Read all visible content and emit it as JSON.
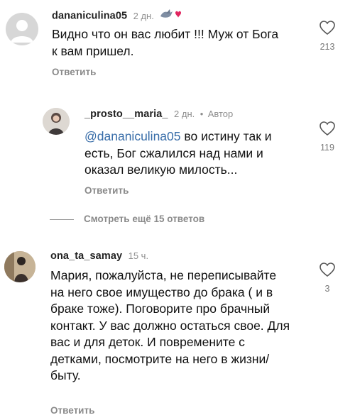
{
  "comments": [
    {
      "username": "dananiculina05",
      "time": "2 дн.",
      "text": "Видно что он вас любит !!! Муж от Бога к вам пришел.",
      "reply_label": "Ответить",
      "likes": "213"
    },
    {
      "username": "_prosto__maria_",
      "time": "2 дн.",
      "author_label": "Автор",
      "mention": "@dananiculina05",
      "text": " во истину так и есть, Бог сжалился над нами и оказал великую милость...",
      "reply_label": "Ответить",
      "likes": "119"
    },
    {
      "username": "ona_ta_samay",
      "time": "15 ч.",
      "text": "Мария, пожалуйста, не переписывайте на него свое имущество до брака ( и в браке тоже). Поговорите про брачный контакт. У вас должно остаться свое. Для вас и для деток. И повремените с детками, посмотрите на него в жизни/быту.",
      "reply_label": "Ответить",
      "likes": "3"
    }
  ],
  "view_more_replies": "Смотреть ещё 15 ответов",
  "colors": {
    "mention": "#376ca8",
    "secondary_text": "#8e8e8e",
    "emoji_heart": "#e0245e"
  },
  "icons": {
    "like": "heart-outline-icon",
    "badge_emoji": "dove-heart-emoji-icon"
  }
}
